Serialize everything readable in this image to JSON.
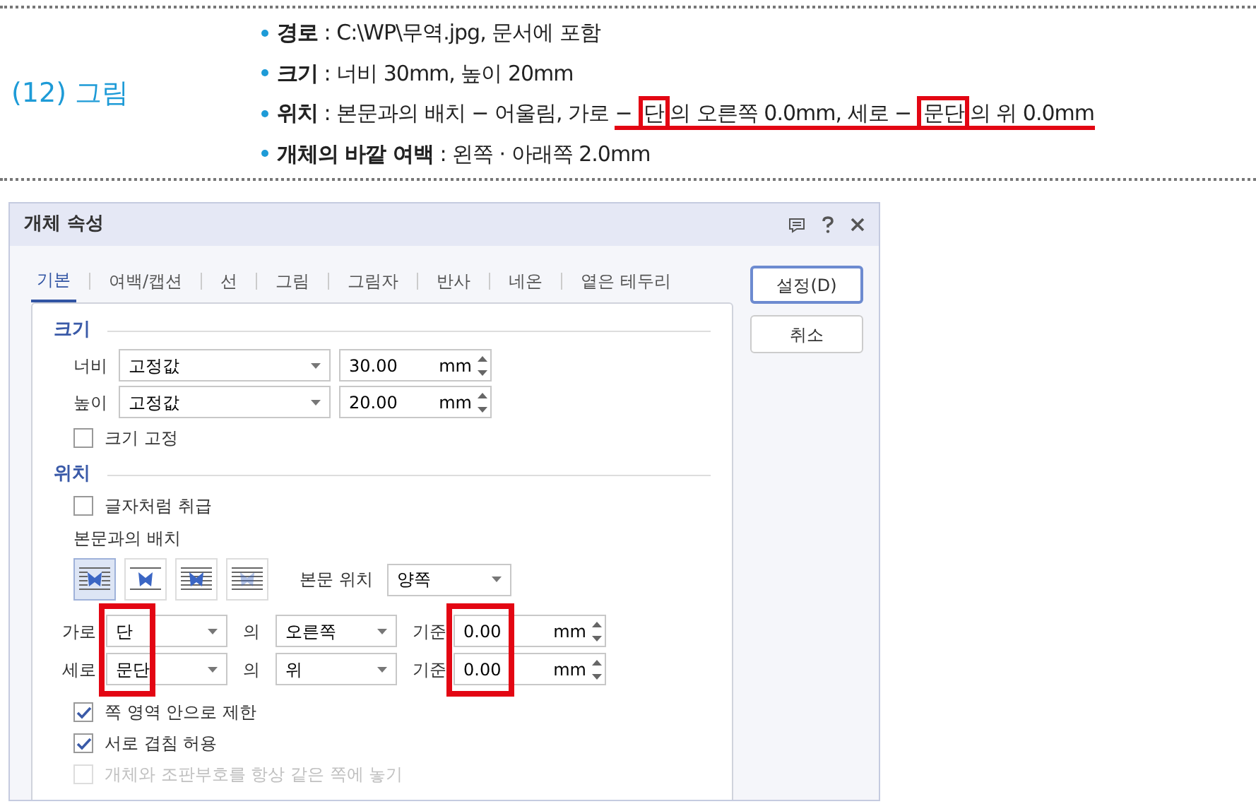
{
  "doc": {
    "heading": "(12) 그림",
    "bullets": [
      {
        "label": "경로",
        "segments": [
          {
            "text": " : C:\\WP\\무역.jpg, 문서에 포함"
          }
        ]
      },
      {
        "label": "크기",
        "segments": [
          {
            "text": " : 너비 30mm, 높이 20mm"
          }
        ]
      },
      {
        "label": "위치",
        "segments": [
          {
            "text": " : 본문과의 배치 − 어울림, 가로 ",
            "underline": false,
            "boxed": false
          },
          {
            "text": "− ",
            "underline": true,
            "boxed": false
          },
          {
            "text": "단",
            "underline": true,
            "boxed": true
          },
          {
            "text": "의 오른쪽 0.0mm, 세로 − ",
            "underline": true,
            "boxed": false
          },
          {
            "text": "문단",
            "underline": true,
            "boxed": true
          },
          {
            "text": "의 위 0.0mm",
            "underline": true,
            "boxed": false
          }
        ]
      },
      {
        "label": "개체의 바깥 여백",
        "segments": [
          {
            "text": " : 왼쪽 · 아래쪽 2.0mm"
          }
        ]
      }
    ]
  },
  "dialog": {
    "title": "개체 속성",
    "tabs": [
      {
        "label": "기본",
        "selected": true
      },
      {
        "label": "여백/캡션",
        "selected": false
      },
      {
        "label": "선",
        "selected": false
      },
      {
        "label": "그림",
        "selected": false
      },
      {
        "label": "그림자",
        "selected": false
      },
      {
        "label": "반사",
        "selected": false
      },
      {
        "label": "네온",
        "selected": false
      },
      {
        "label": "옅은 테두리",
        "selected": false
      }
    ],
    "buttons": [
      {
        "label": "설정(D)",
        "default": true
      },
      {
        "label": "취소",
        "default": false
      }
    ],
    "size": {
      "title": "크기",
      "rows": [
        {
          "label": "너비",
          "mode": "고정값",
          "value": "30.00",
          "unit": "mm"
        },
        {
          "label": "높이",
          "mode": "고정값",
          "value": "20.00",
          "unit": "mm"
        }
      ],
      "lock": {
        "label": "크기 고정",
        "checked": false
      }
    },
    "position": {
      "title": "위치",
      "as_char": {
        "label": "글자처럼 취급",
        "checked": false
      },
      "wrap_label": "본문과의 배치",
      "wrap_options": [
        {
          "selected": true
        },
        {
          "selected": false
        },
        {
          "selected": false
        },
        {
          "selected": false
        }
      ],
      "text_pos_label": "본문 위치",
      "text_pos": "양쪽",
      "rows": [
        {
          "label": "가로",
          "ref": "단",
          "of": "의",
          "side": "오른쪽",
          "base": "기준",
          "value": "0.00",
          "unit": "mm",
          "annotated": true
        },
        {
          "label": "세로",
          "ref": "문단",
          "of": "의",
          "side": "위",
          "base": "기준",
          "value": "0.00",
          "unit": "mm",
          "annotated": true
        }
      ],
      "options": [
        {
          "label": "쪽 영역 안으로 제한",
          "checked": true,
          "disabled": false
        },
        {
          "label": "서로 겹침 허용",
          "checked": true,
          "disabled": false
        },
        {
          "label": "개체와 조판부호를 항상 같은 쪽에 놓기",
          "checked": false,
          "disabled": true
        }
      ]
    }
  }
}
